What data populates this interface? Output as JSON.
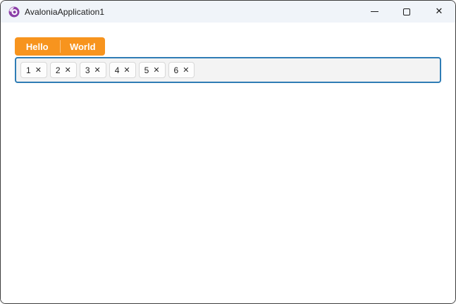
{
  "window": {
    "title": "AvaloniaApplication1",
    "controls": {
      "minimize_label": "minimize",
      "maximize_label": "maximize",
      "close_glyph": "✕"
    }
  },
  "split_button": {
    "left_label": "Hello",
    "right_label": "World"
  },
  "tag_input": {
    "chips": [
      "1",
      "2",
      "3",
      "4",
      "5",
      "6"
    ],
    "remove_glyph": "✕"
  },
  "colors": {
    "accent_orange": "#f7941e",
    "focus_border_blue": "#2e7cb5",
    "titlebar_bg": "#f0f4f9",
    "window_border": "#3c3c3c",
    "chip_bg": "#fdfdfd",
    "chip_border": "#d8d8d8",
    "logo_purple": "#8b3fa8"
  }
}
